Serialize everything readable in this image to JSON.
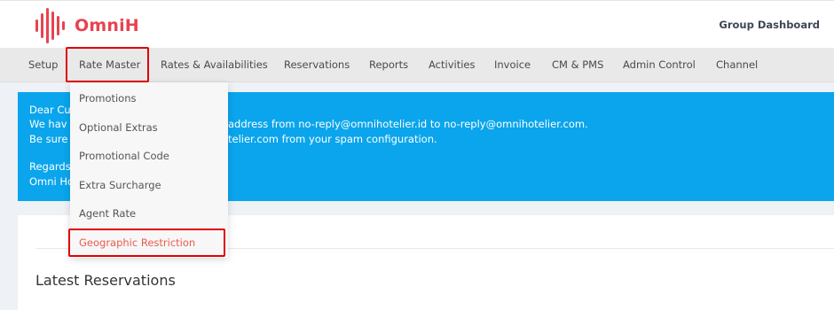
{
  "header": {
    "logo_text": "OmniH",
    "brand_color": "#e8434f",
    "right_link": "Group Dashboard"
  },
  "nav": {
    "items": [
      "Setup",
      "Rate Master",
      "Rates & Availabilities",
      "Reservations",
      "Reports",
      "Activities",
      "Invoice",
      "CM & PMS",
      "Admin Control",
      "Channel"
    ],
    "highlighted": "Rate Master"
  },
  "dropdown": {
    "items": [
      "Promotions",
      "Optional Extras",
      "Promotional Code",
      "Extra Surcharge",
      "Agent Rate",
      "Geographic Restriction"
    ],
    "highlighted": "Geographic Restriction"
  },
  "banner": {
    "line1_left": "Dear Cu",
    "line2_left": "We hav",
    "line2_right": "address from no-reply@omnihotelier.id to no-reply@omnihotelier.com.",
    "line3_left": "Be sure",
    "line3_right": "telier.com from your spam configuration.",
    "line5_left": "Regards",
    "line6_left": "Omni Ho",
    "color": "#0aa5ec"
  },
  "main": {
    "section_title": "Latest Reservations"
  }
}
